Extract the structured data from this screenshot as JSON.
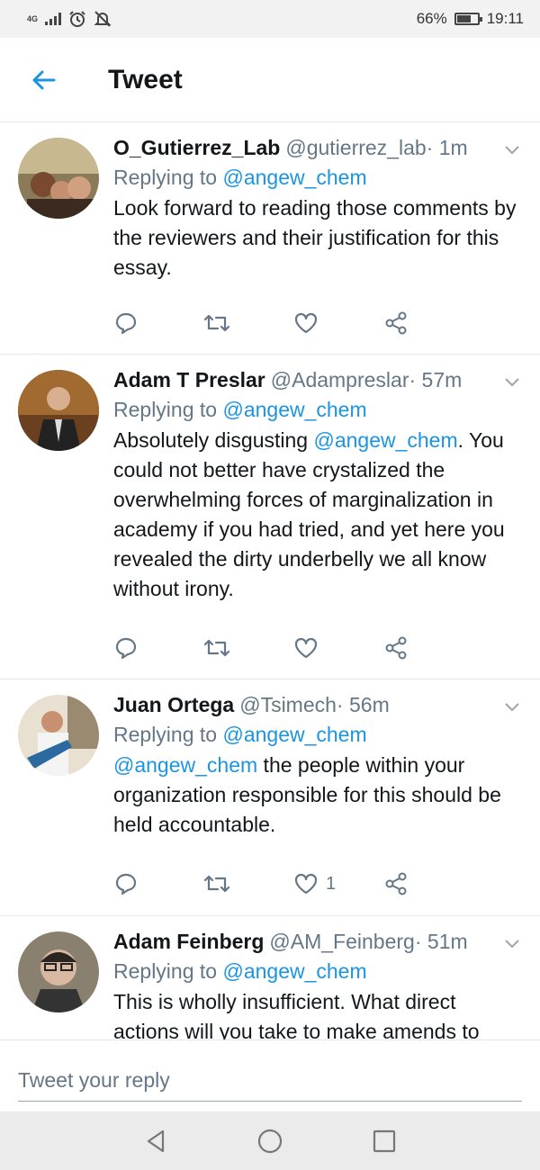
{
  "status_bar": {
    "network": "4G",
    "battery_text": "66%",
    "battery_level": 0.66,
    "time": "19:11",
    "icons": [
      "signal-icon",
      "alarm-icon",
      "mute-icon",
      "battery-icon"
    ]
  },
  "header": {
    "title": "Tweet",
    "back_icon": "arrow-left-icon"
  },
  "colors": {
    "accent": "#1b95e0",
    "text": "#14171a",
    "muted": "#657786",
    "divider": "#e1e8ed"
  },
  "tweets": [
    {
      "name": "O_Gutierrez_Lab",
      "handle": "@gutierrez_lab",
      "time": "1m",
      "replying_label": "Replying to",
      "replying_to": "@angew_chem",
      "text_mention": "",
      "text": "Look forward to reading those comments by the reviewers and their justification for this essay.",
      "like_count": ""
    },
    {
      "name": "Adam T Preslar",
      "handle": "@Adampreslar",
      "time": "57m",
      "replying_label": "Replying to",
      "replying_to": "@angew_chem",
      "text_pre": "Absolutely disgusting ",
      "text_mention": "@angew_chem",
      "text": ". You could not better have crystalized the overwhelming forces of marginalization in academy if you had tried, and yet here you revealed the dirty underbelly we all know without irony.",
      "like_count": ""
    },
    {
      "name": "Juan Ortega",
      "handle": "@Tsimech",
      "time": "56m",
      "replying_label": "Replying to",
      "replying_to": "@angew_chem",
      "text_mention": "@angew_chem",
      "text": " the people within your organization responsible for this should be held accountable.",
      "like_count": "1"
    },
    {
      "name": "Adam Feinberg",
      "handle": "@AM_Feinberg",
      "time": "51m",
      "replying_label": "Replying to",
      "replying_to": "@angew_chem",
      "text_mention": "",
      "text": "This is wholly insufficient. What direct actions will you take to make amends to",
      "like_count": ""
    }
  ],
  "reply_bar": {
    "placeholder": "Tweet your reply"
  },
  "nav_bar": {
    "buttons": [
      "back-triangle-icon",
      "home-circle-icon",
      "recents-square-icon"
    ]
  }
}
